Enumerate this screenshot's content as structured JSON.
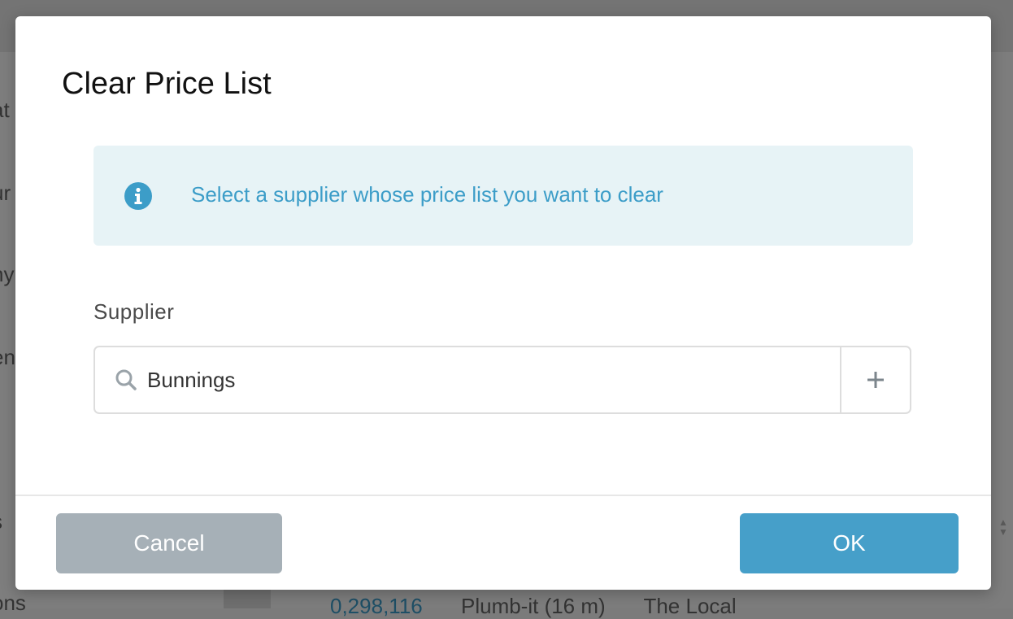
{
  "background": {
    "sidebar_items": [
      {
        "label": "at"
      },
      {
        "label": "ur"
      },
      {
        "label": "ny"
      },
      {
        "label": "ent"
      },
      {
        "label": "s"
      },
      {
        "label": "ons"
      }
    ],
    "row": {
      "link": "0,298,116",
      "col1": "Plumb-it (16 m)",
      "col2": "The Local"
    }
  },
  "modal": {
    "title": "Clear Price List",
    "info": {
      "icon": "info-circle-icon",
      "message": "Select a supplier whose price list you want to clear"
    },
    "supplier": {
      "label": "Supplier",
      "value": "Bunnings",
      "search_icon": "search-icon",
      "add_icon": "plus-icon"
    },
    "buttons": {
      "cancel_label": "Cancel",
      "ok_label": "OK"
    }
  },
  "colors": {
    "overlay": "#7b7b7b",
    "info_bg": "#e7f3f6",
    "info_text": "#3c9dc8",
    "ok_button": "#469fc9",
    "cancel_button": "#a6b0b7"
  }
}
